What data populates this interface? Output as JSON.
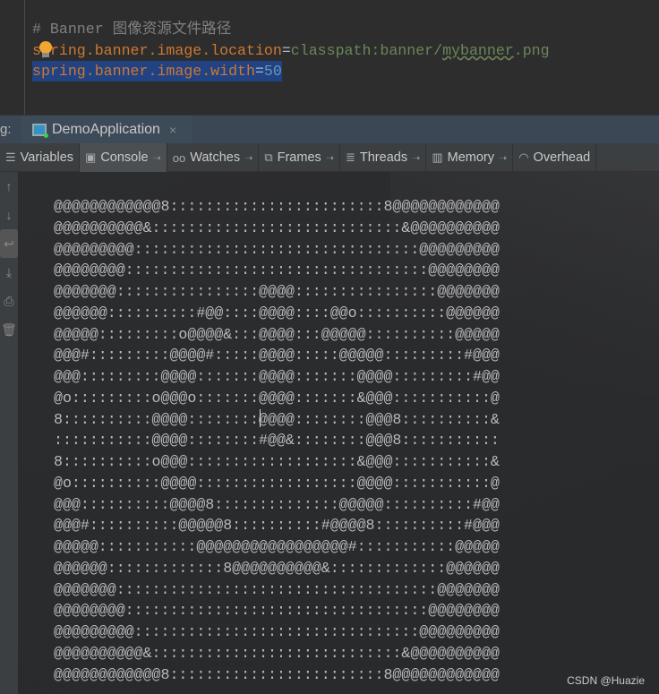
{
  "editor": {
    "comment": "# Banner 图像资源文件路径",
    "line2_key": "spring.banner.image.location",
    "line2_eq": "=",
    "line2_val_a": "classpath:banner/",
    "line2_val_b": "mybanner",
    "line2_val_c": ".png",
    "line3_key": "spring.banner.image.width",
    "line3_eq": "=",
    "line3_val": "50"
  },
  "debug_bar": {
    "label": "g:",
    "run_tab": "DemoApplication",
    "close": "×"
  },
  "toolbar": {
    "tabs": [
      "Variables",
      "Console",
      "Watches",
      "Frames",
      "Threads",
      "Memory",
      "Overhead"
    ],
    "active": "Console"
  },
  "console": {
    "lines": [
      "@@@@@@@@@@@@8::::::::::::::::::::::::8@@@@@@@@@@@@",
      "@@@@@@@@@@&::::::::::::::::::::::::::::&@@@@@@@@@@",
      "@@@@@@@@@::::::::::::::::::::::::::::::::@@@@@@@@@",
      "@@@@@@@@::::::::::::::::::::::::::::::::::@@@@@@@@",
      "@@@@@@@::::::::::::::::@@@@::::::::::::::::@@@@@@@",
      "@@@@@@::::::::::#@@::::@@@@::::@@o::::::::::@@@@@@",
      "@@@@@:::::::::o@@@@&:::@@@@:::@@@@@::::::::::@@@@@",
      "@@@#:::::::::@@@@#:::::@@@@:::::@@@@@:::::::::#@@@",
      "@@@:::::::::@@@@:::::::@@@@:::::::@@@@:::::::::#@@",
      "@o:::::::::o@@@o:::::::@@@@:::::::&@@@:::::::::::@",
      "8::::::::::@@@@::::::::@@@@::::::::@@@8::::::::::&",
      ":::::::::::@@@@::::::::#@@&::::::::@@@8:::::::::::",
      "8::::::::::o@@@:::::::::::::::::::&@@@:::::::::::&",
      "@o::::::::::@@@@::::::::::::::::::@@@@:::::::::::@",
      "@@@::::::::::@@@@8::::::::::::::@@@@@::::::::::#@@",
      "@@@#::::::::::@@@@@8::::::::::#@@@@8::::::::::#@@@",
      "@@@@@:::::::::::@@@@@@@@@@@@@@@@@#:::::::::::@@@@@",
      "@@@@@@:::::::::::::8@@@@@@@@@@&:::::::::::::@@@@@@",
      "@@@@@@@::::::::::::::::::::::::::::::::::::@@@@@@@",
      "@@@@@@@@::::::::::::::::::::::::::::::::::@@@@@@@@",
      "@@@@@@@@@::::::::::::::::::::::::::::::::@@@@@@@@@",
      "@@@@@@@@@@&::::::::::::::::::::::::::::&@@@@@@@@@@",
      "@@@@@@@@@@@@8::::::::::::::::::::::::8@@@@@@@@@@@@"
    ]
  },
  "watermark": "CSDN @Huazie"
}
